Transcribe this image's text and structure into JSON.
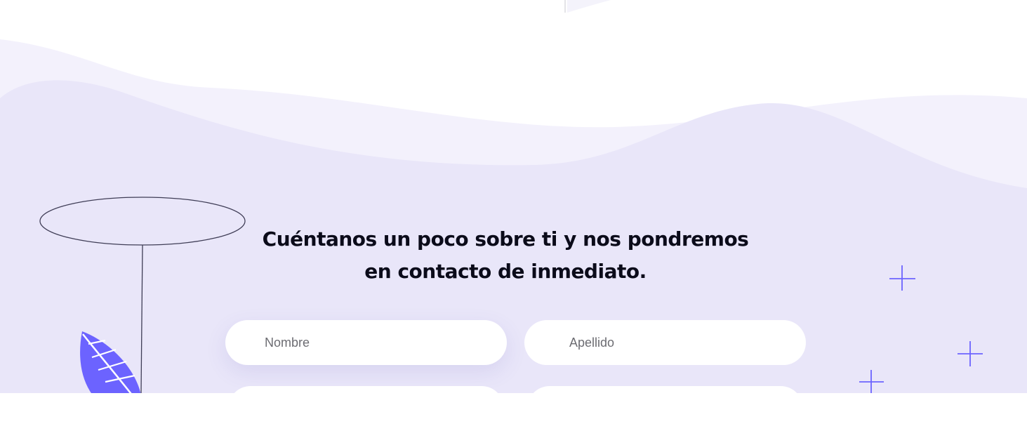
{
  "contact": {
    "heading_line1": "Cuéntanos un poco sobre ti y nos pondremos",
    "heading_line2": "en contacto de inmediato.",
    "fields": {
      "nombre_placeholder": "Nombre",
      "apellido_placeholder": "Apellido"
    }
  },
  "colors": {
    "section_bg": "#e9e6f9",
    "wave_light": "#f3f1fc",
    "leaf": "#6c63ff",
    "sparkle": "#6c63ff",
    "ring_outline": "#3f3d56",
    "heading": "#0b0b1a"
  },
  "icons": [
    "leaf-icon",
    "sparkle-icon",
    "ring-outline-icon"
  ]
}
